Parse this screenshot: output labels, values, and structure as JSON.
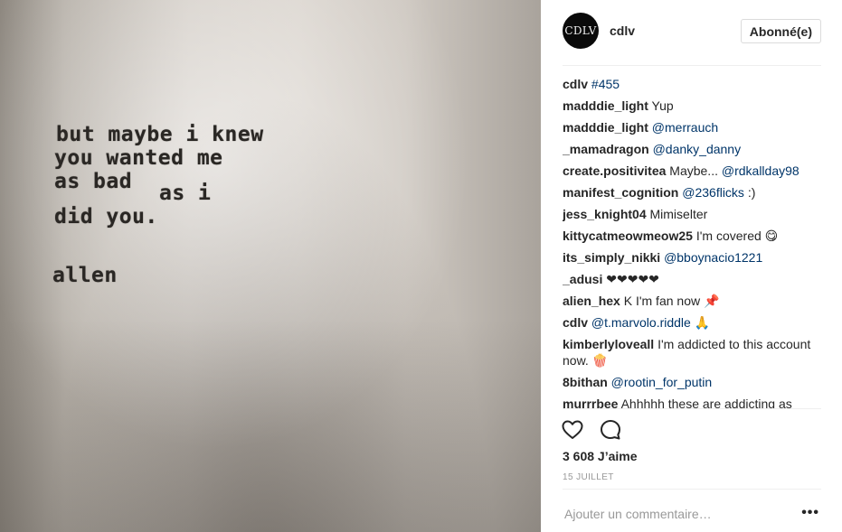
{
  "photo": {
    "lines": [
      "but maybe i knew",
      "you wanted me",
      "as bad",
      "as i",
      "did you.",
      "allen"
    ]
  },
  "header": {
    "avatar_text": "CDLV",
    "username": "cdlv",
    "follow_label": "Abonné(e)"
  },
  "comments": [
    {
      "user": "cdlv",
      "text": "",
      "mention": "#455"
    },
    {
      "user": "madddie_light",
      "text": "Yup",
      "mention": ""
    },
    {
      "user": "madddie_light",
      "text": "",
      "mention": "@merrauch"
    },
    {
      "user": "_mamadragon",
      "text": "",
      "mention": "@danky_danny"
    },
    {
      "user": "create.positivitea",
      "text": "Maybe...",
      "mention": "@rdkallday98"
    },
    {
      "user": "manifest_cognition",
      "text": "",
      "mention": "@236flicks",
      "after": ":)"
    },
    {
      "user": "jess_knight04",
      "text": "Mimiselter",
      "mention": ""
    },
    {
      "user": "kittycatmeowmeow25",
      "text": "I'm covered 😋",
      "mention": ""
    },
    {
      "user": "its_simply_nikki",
      "text": "",
      "mention": "@bboynacio1221"
    },
    {
      "user": "_adusi",
      "text": "❤❤❤❤❤",
      "mention": ""
    },
    {
      "user": "alien_hex",
      "text": "K I'm fan now 📌",
      "mention": ""
    },
    {
      "user": "cdlv",
      "text": "",
      "mention": "@t.marvolo.riddle",
      "after": "🙏"
    },
    {
      "user": "kimberlyloveall",
      "text": "I'm addicted to this account now. 🍿",
      "mention": ""
    },
    {
      "user": "8bithan",
      "text": "",
      "mention": "@rootin_for_putin"
    },
    {
      "user": "murrrbee",
      "text": "Ahhhhh these are addicting as",
      "mention": ""
    }
  ],
  "actions": {
    "heart_icon": "heart-outline-icon",
    "comment_icon": "comment-bubble-icon",
    "likes": "3 608 J’aime",
    "date": "15 JUILLET"
  },
  "add_comment": {
    "placeholder": "Ajouter un commentaire…",
    "more_label": "•••"
  }
}
